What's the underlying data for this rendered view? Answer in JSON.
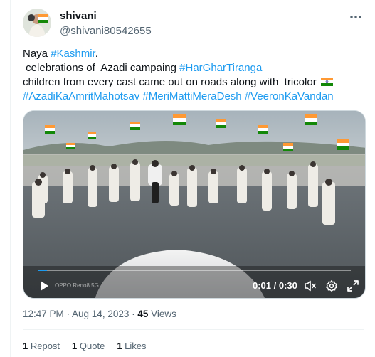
{
  "tweet": {
    "author_name": "shivani",
    "author_handle": "@shivani80542655",
    "text": {
      "l1_pre": "Naya ",
      "l1_tag": "#Kashmir",
      "l1_post": ".",
      "l2_pre": "celebrations of  Azadi campaing ",
      "l2_tag": "#HarGharTiranga",
      "l3": "children from every cast came out on roads along with  tricolor ",
      "l4_tags": [
        "#AzadiKaAmritMahotsav",
        "#MeriMattiMeraDesh",
        "#VeeronKaVandan"
      ]
    },
    "video": {
      "time": "0:01 / 0:30",
      "watermark": "OPPO Reno8 5G",
      "progress": 0.03
    },
    "timestamp": "12:47 PM · Aug 14, 2023 · ",
    "views_count": "45",
    "views_label": " Views",
    "stats": {
      "reposts_count": "1",
      "reposts_label": " Repost",
      "quotes_count": "1",
      "quotes_label": " Quote",
      "likes_count": "1",
      "likes_label": " Likes"
    }
  },
  "icons": [
    "more-icon",
    "play-icon",
    "mute-icon",
    "settings-icon",
    "fullscreen-icon",
    "india-flag-emoji"
  ],
  "colors": {
    "link": "#1d9bf0",
    "muted": "#536471",
    "text": "#0f1419"
  }
}
